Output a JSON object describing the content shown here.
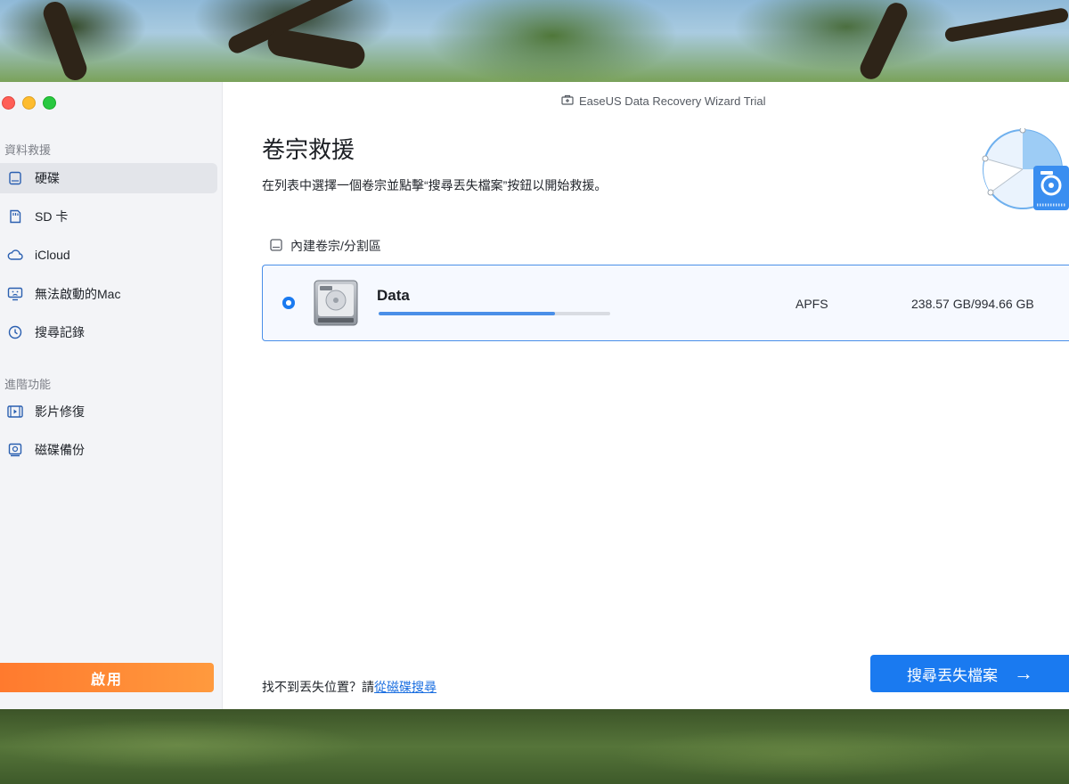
{
  "window": {
    "title": "EaseUS Data Recovery Wizard  Trial"
  },
  "sidebar": {
    "section_recovery": "資料救援",
    "items": [
      {
        "label": "硬碟",
        "icon": "drive-icon"
      },
      {
        "label": "SD 卡",
        "icon": "sd-card-icon"
      },
      {
        "label": "iCloud",
        "icon": "cloud-icon"
      },
      {
        "label": "無法啟動的Mac",
        "icon": "unbootable-mac-icon"
      },
      {
        "label": "搜尋記錄",
        "icon": "history-clock-icon"
      }
    ],
    "section_advanced": "進階功能",
    "advanced_items": [
      {
        "label": "影片修復",
        "icon": "video-repair-icon"
      },
      {
        "label": "磁碟備份",
        "icon": "disk-backup-icon"
      }
    ],
    "activate_label": "啟用"
  },
  "main": {
    "title": "卷宗救援",
    "subtitle": "在列表中選擇一個卷宗並點擊“搜尋丟失檔案”按鈕以開始救援。",
    "group_header": "內建卷宗/分割區",
    "volumes": [
      {
        "name": "Data",
        "filesystem": "APFS",
        "capacity": "238.57 GB/994.66 GB",
        "usage_fraction": 0.76,
        "selected": true
      }
    ],
    "footer_prefix": "找不到丟失位置？請",
    "footer_link": "從磁碟搜尋",
    "scan_button": "搜尋丟失檔案",
    "scan_arrow": "→"
  },
  "colors": {
    "accent": "#1a7af0",
    "activate": "#ff8a36"
  }
}
